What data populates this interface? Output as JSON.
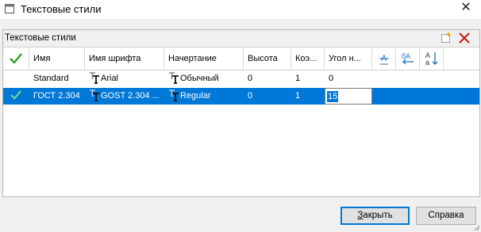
{
  "window": {
    "title": "Текстовые стили"
  },
  "panel": {
    "title": "Текстовые стили"
  },
  "table": {
    "headers": {
      "name": "Имя",
      "font": "Имя шрифта",
      "style": "Начертание",
      "height": "Высота",
      "coef": "Коэ...",
      "angle": "Угол н..."
    },
    "header_icons": [
      "underline-text-icon",
      "reverse-text-icon",
      "sort-az-icon"
    ],
    "rows": [
      {
        "name": "Standard",
        "font": "Arial",
        "style": "Обычный",
        "height": "0",
        "coef": "1",
        "angle": "0",
        "active": false,
        "selected": false
      },
      {
        "name": "ГОСТ 2.304",
        "font": "GOST 2.304 ...",
        "style": "Regular",
        "height": "0",
        "coef": "1",
        "angle": "15",
        "active": true,
        "selected": true
      }
    ]
  },
  "buttons": {
    "close_first": "З",
    "close_rest": "акрыть",
    "help": "Справка"
  },
  "colors": {
    "selection": "#0078d7",
    "check": "#2e9e2e",
    "delete": "#c41f1f"
  }
}
